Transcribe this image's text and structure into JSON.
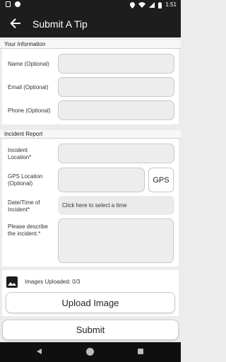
{
  "status_bar": {
    "time": "1:51"
  },
  "app_bar": {
    "title": "Submit A Tip"
  },
  "your_info": {
    "header": "Your Information",
    "name_label": "Name (Optional)",
    "email_label": "Email (Optional)",
    "phone_label": "Phone (Optional)"
  },
  "incident": {
    "header": "Incident Report",
    "location_label": "Incident Location*",
    "gps_label": "GPS Location (Optional)",
    "gps_button": "GPS",
    "datetime_label": "Date/Time of Incident*",
    "datetime_placeholder": "Click here to select a time",
    "describe_label": "Please describe the incident.*"
  },
  "images": {
    "uploaded_text": "Images Uploaded: 0/3",
    "upload_button": "Upload Image"
  },
  "submit_button": "Submit"
}
